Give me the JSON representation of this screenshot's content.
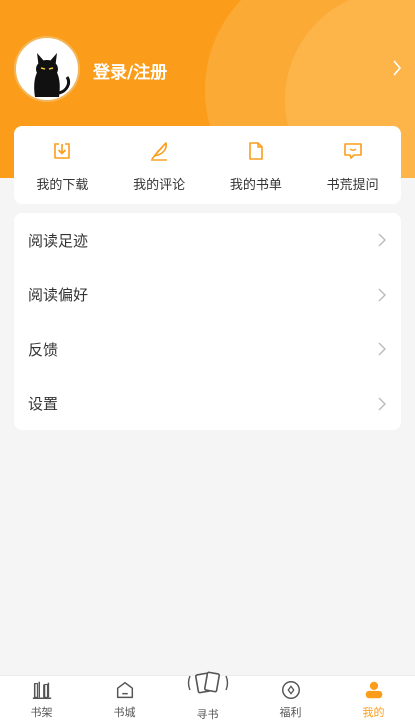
{
  "profile": {
    "login_label": "登录/注册"
  },
  "quick_actions": [
    {
      "label": "我的下载",
      "icon": "download-icon"
    },
    {
      "label": "我的评论",
      "icon": "feather-icon"
    },
    {
      "label": "我的书单",
      "icon": "document-icon"
    },
    {
      "label": "书荒提问",
      "icon": "message-icon"
    }
  ],
  "menu": [
    {
      "label": "阅读足迹"
    },
    {
      "label": "阅读偏好"
    },
    {
      "label": "反馈"
    },
    {
      "label": "设置"
    }
  ],
  "tabs": [
    {
      "label": "书架",
      "icon": "bookshelf-icon"
    },
    {
      "label": "书城",
      "icon": "bookstore-icon"
    },
    {
      "label": "寻书",
      "icon": "find-book-icon"
    },
    {
      "label": "福利",
      "icon": "welfare-icon"
    },
    {
      "label": "我的",
      "icon": "profile-icon",
      "active": true
    }
  ],
  "colors": {
    "accent": "#fb9d1a",
    "background": "#f5f5f5"
  }
}
